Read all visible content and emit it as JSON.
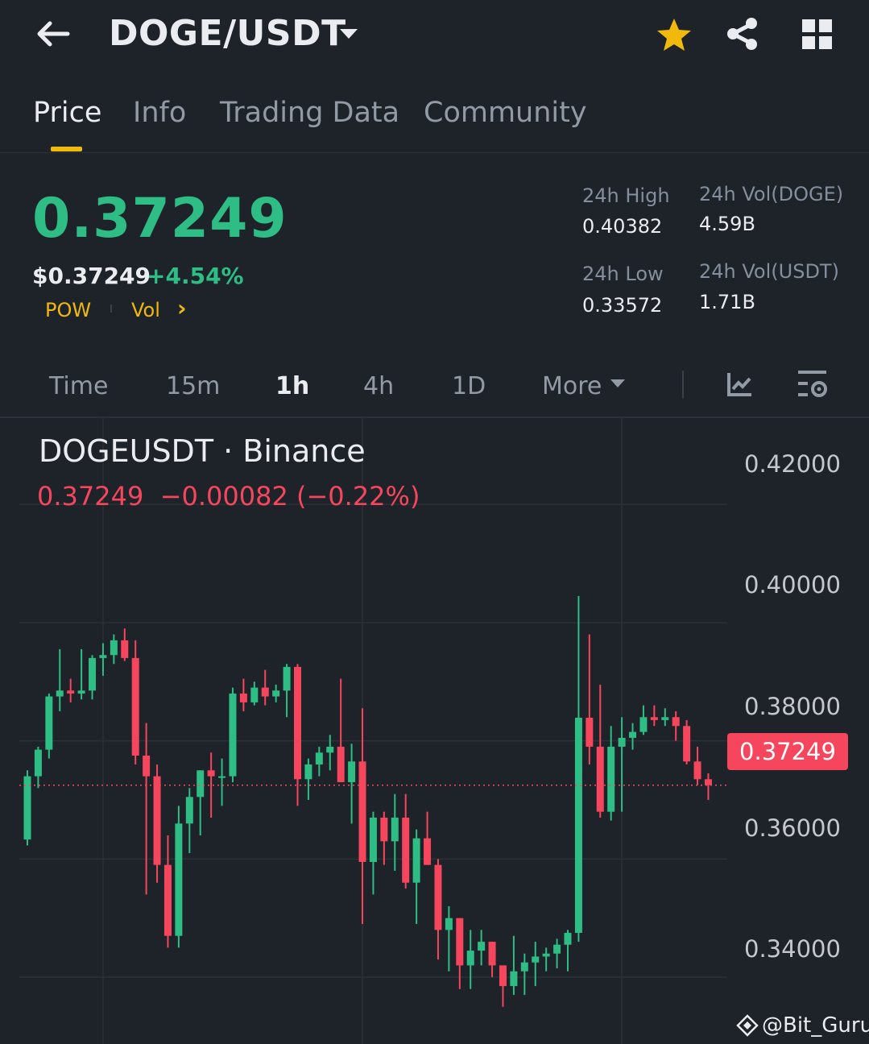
{
  "header": {
    "pair": "DOGE/USDT",
    "icons": [
      "back-arrow-icon",
      "caret-down-icon",
      "star-icon",
      "share-icon",
      "grid-icon"
    ],
    "star_color": "#f0b90b"
  },
  "tabs": [
    {
      "label": "Price",
      "active": true
    },
    {
      "label": "Info"
    },
    {
      "label": "Trading Data"
    },
    {
      "label": "Community"
    }
  ],
  "ticker": {
    "last_price": "0.37249",
    "usd_price": "$0.37249",
    "change_pct": "+4.54%",
    "tag1": "POW",
    "tag2": "Vol",
    "tag2_chevron": "›",
    "high_label": "24h High",
    "high_value": "0.40382",
    "low_label": "24h Low",
    "low_value": "0.33572",
    "vol_base_label": "24h Vol(DOGE)",
    "vol_base_value": "4.59B",
    "vol_quote_label": "24h Vol(USDT)",
    "vol_quote_value": "1.71B"
  },
  "timeframes": [
    {
      "label": "Time"
    },
    {
      "label": "15m"
    },
    {
      "label": "1h",
      "active": true
    },
    {
      "label": "4h"
    },
    {
      "label": "1D"
    },
    {
      "label": "More"
    }
  ],
  "chart_tools": [
    "indicator-icon",
    "chart-settings-icon"
  ],
  "colors": {
    "up": "#2ebd85",
    "down": "#f6465d",
    "accent": "#f0b90b",
    "background": "#1e2329"
  },
  "chart_data": {
    "type": "candlestick",
    "title": "DOGEUSDT · Binance",
    "ohlc_readout": "0.37249  −0.00082 (−0.22%)",
    "y_ticks": [
      "0.42000",
      "0.40000",
      "0.38000",
      "0.36000",
      "0.34000"
    ],
    "ylim": [
      0.3287,
      0.4346
    ],
    "current_price_label": "0.37249",
    "current_price": 0.37249,
    "candles": [
      [
        0.3633,
        0.375,
        0.3623,
        0.374
      ],
      [
        0.374,
        0.379,
        0.372,
        0.3785
      ],
      [
        0.3785,
        0.388,
        0.377,
        0.3875
      ],
      [
        0.3875,
        0.3955,
        0.385,
        0.3885
      ],
      [
        0.3885,
        0.3905,
        0.3865,
        0.388
      ],
      [
        0.388,
        0.3955,
        0.387,
        0.3885
      ],
      [
        0.3885,
        0.3945,
        0.387,
        0.394
      ],
      [
        0.394,
        0.3965,
        0.391,
        0.3945
      ],
      [
        0.3945,
        0.398,
        0.393,
        0.397
      ],
      [
        0.397,
        0.399,
        0.3935,
        0.394
      ],
      [
        0.394,
        0.397,
        0.376,
        0.3775
      ],
      [
        0.3775,
        0.383,
        0.354,
        0.374
      ],
      [
        0.374,
        0.376,
        0.356,
        0.359
      ],
      [
        0.359,
        0.364,
        0.345,
        0.347
      ],
      [
        0.347,
        0.369,
        0.345,
        0.366
      ],
      [
        0.366,
        0.372,
        0.361,
        0.3705
      ],
      [
        0.3705,
        0.375,
        0.364,
        0.375
      ],
      [
        0.375,
        0.378,
        0.367,
        0.374
      ],
      [
        0.374,
        0.377,
        0.369,
        0.374
      ],
      [
        0.374,
        0.389,
        0.373,
        0.388
      ],
      [
        0.388,
        0.3905,
        0.385,
        0.3865
      ],
      [
        0.3865,
        0.39,
        0.386,
        0.389
      ],
      [
        0.389,
        0.392,
        0.386,
        0.3875
      ],
      [
        0.3875,
        0.3895,
        0.3865,
        0.3885
      ],
      [
        0.3885,
        0.393,
        0.384,
        0.3925
      ],
      [
        0.3925,
        0.393,
        0.369,
        0.3735
      ],
      [
        0.3735,
        0.377,
        0.37,
        0.376
      ],
      [
        0.376,
        0.379,
        0.374,
        0.378
      ],
      [
        0.378,
        0.381,
        0.375,
        0.379
      ],
      [
        0.379,
        0.3905,
        0.373,
        0.373
      ],
      [
        0.373,
        0.3795,
        0.366,
        0.3765
      ],
      [
        0.3765,
        0.3855,
        0.349,
        0.3595
      ],
      [
        0.3595,
        0.368,
        0.354,
        0.367
      ],
      [
        0.367,
        0.368,
        0.359,
        0.363
      ],
      [
        0.363,
        0.371,
        0.358,
        0.367
      ],
      [
        0.367,
        0.371,
        0.355,
        0.356
      ],
      [
        0.356,
        0.365,
        0.349,
        0.3635
      ],
      [
        0.3635,
        0.368,
        0.359,
        0.359
      ],
      [
        0.359,
        0.36,
        0.343,
        0.348
      ],
      [
        0.348,
        0.352,
        0.341,
        0.35
      ],
      [
        0.35,
        0.35,
        0.338,
        0.342
      ],
      [
        0.342,
        0.348,
        0.338,
        0.3445
      ],
      [
        0.3445,
        0.348,
        0.342,
        0.346
      ],
      [
        0.346,
        0.346,
        0.34,
        0.342
      ],
      [
        0.342,
        0.342,
        0.335,
        0.3385
      ],
      [
        0.3385,
        0.347,
        0.337,
        0.341
      ],
      [
        0.341,
        0.344,
        0.337,
        0.3425
      ],
      [
        0.3425,
        0.346,
        0.3385,
        0.3435
      ],
      [
        0.3435,
        0.345,
        0.341,
        0.344
      ],
      [
        0.344,
        0.3465,
        0.3415,
        0.3455
      ],
      [
        0.3455,
        0.348,
        0.341,
        0.3475
      ],
      [
        0.3475,
        0.4045,
        0.346,
        0.3839
      ],
      [
        0.3839,
        0.398,
        0.376,
        0.379
      ],
      [
        0.379,
        0.3895,
        0.367,
        0.368
      ],
      [
        0.368,
        0.3825,
        0.3665,
        0.379
      ],
      [
        0.379,
        0.384,
        0.368,
        0.3805
      ],
      [
        0.3805,
        0.383,
        0.3785,
        0.3815
      ],
      [
        0.3815,
        0.386,
        0.381,
        0.384
      ],
      [
        0.384,
        0.386,
        0.3825,
        0.3835
      ],
      [
        0.3835,
        0.3855,
        0.3825,
        0.384
      ],
      [
        0.384,
        0.385,
        0.38,
        0.3825
      ],
      [
        0.3825,
        0.3835,
        0.376,
        0.3765
      ],
      [
        0.3765,
        0.379,
        0.3725,
        0.3735
      ],
      [
        0.3735,
        0.3745,
        0.37,
        0.3725
      ]
    ]
  },
  "watermark": "@Bit_Guru"
}
